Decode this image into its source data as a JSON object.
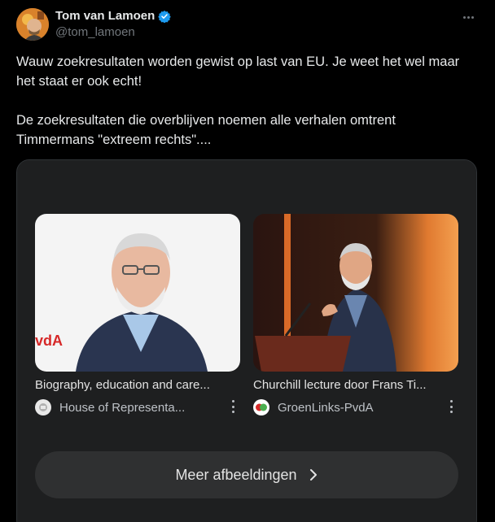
{
  "author": {
    "display_name": "Tom van Lamoen",
    "handle": "@tom_lamoen",
    "verified": true
  },
  "tweet": {
    "paragraphs": [
      "Wauw zoekresultaten worden gewist op last van EU. Je weet het wel maar het staat er ook echt!",
      "De zoekresultaten die overblijven noemen alle verhalen omtrent Timmermans \"extreem rechts\"...."
    ]
  },
  "image_results": [
    {
      "title": "Biography, education and care...",
      "source": "House of Representa...",
      "image_text": "vdA"
    },
    {
      "title": "Churchill lecture door Frans Ti...",
      "source": "GroenLinks-PvdA"
    }
  ],
  "more_images_label": "Meer afbeeldingen",
  "colors": {
    "background": "#000000",
    "card_background": "#1e1f20",
    "verified_blue": "#1d9bf0",
    "button_background": "#2f3031"
  }
}
